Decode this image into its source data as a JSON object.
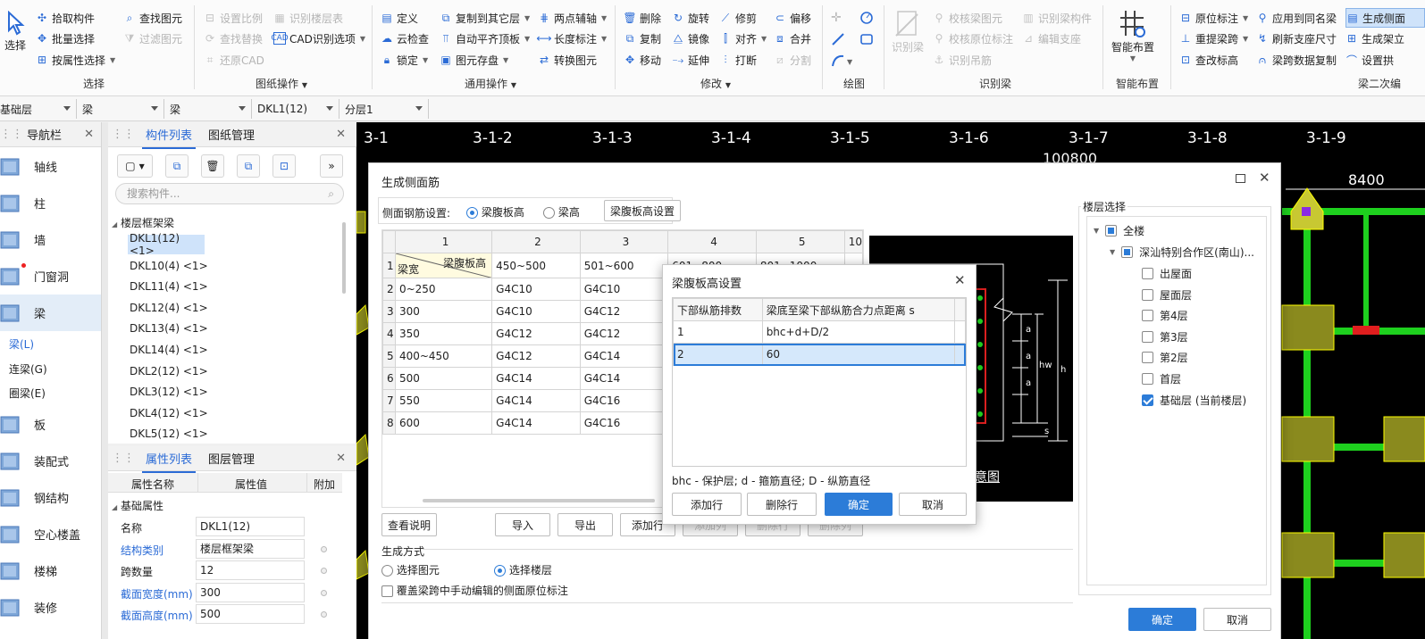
{
  "ribbon": {
    "select": {
      "label": "选择",
      "pick": "拾取构件",
      "batch": "批量选择",
      "by_attr": "按属性选择",
      "find": "查找图元",
      "filter": "过滤图元"
    },
    "drawing_ops": {
      "label": "图纸操作",
      "set_scale": "设置比例",
      "find_replace": "查找替换",
      "restore_cad": "还原CAD",
      "identify_floor": "识别楼层表",
      "cad_options": "CAD识别选项"
    },
    "general_ops": {
      "label": "通用操作",
      "define": "定义",
      "cloud_check": "云检查",
      "lock": "锁定",
      "copy_floor": "复制到其它层",
      "auto_flat": "自动平齐顶板",
      "elem_storage": "图元存盘",
      "two_point_axis": "两点辅轴",
      "length_mark": "长度标注",
      "convert_elem": "转换图元"
    },
    "modify": {
      "label": "修改",
      "delete": "删除",
      "copy": "复制",
      "move": "移动",
      "rotate": "旋转",
      "mirror": "镜像",
      "extend": "延伸",
      "trim": "修剪",
      "align": "对齐",
      "break": "打断",
      "offset": "偏移",
      "merge": "合并",
      "split": "分割"
    },
    "draw": {
      "label": "绘图"
    },
    "identify_beam": {
      "label": "识别梁",
      "identify": "识别梁",
      "check_beam": "校核梁图元",
      "check_orig": "校核原位标注",
      "hanger": "识别吊筋",
      "identify_comp": "识别梁构件",
      "edit_support": "编辑支座"
    },
    "smart_layout": {
      "label": "智能布置",
      "btn": "智能布置"
    },
    "beam_secondary": {
      "label": "梁二次编",
      "orig_mark": "原位标注",
      "re_span": "重提梁跨",
      "check_elev": "查改标高",
      "apply_same": "应用到同名梁",
      "refresh_support": "刷新支座尺寸",
      "span_copy": "梁跨数据复制",
      "gen_side": "生成侧面",
      "gen_hang": "生成架立",
      "set_arch": "设置拱"
    }
  },
  "selbar": {
    "floor": "基础层",
    "type1": "梁",
    "type2": "梁",
    "comp": "DKL1(12)",
    "layer": "分层1"
  },
  "nav": {
    "title": "导航栏",
    "items": [
      "轴线",
      "柱",
      "墙",
      "门窗洞",
      "梁",
      "板",
      "装配式",
      "钢结构",
      "空心楼盖",
      "楼梯",
      "装修"
    ],
    "beam_subs": [
      "梁(L)",
      "连梁(G)",
      "圈梁(E)"
    ]
  },
  "comp_panel": {
    "tab_list": "构件列表",
    "tab_drawing": "图纸管理",
    "search_placeholder": "搜索构件...",
    "group": "楼层框架梁",
    "items": [
      "DKL1(12) <1>",
      "DKL10(4) <1>",
      "DKL11(4) <1>",
      "DKL12(4) <1>",
      "DKL13(4) <1>",
      "DKL14(4) <1>",
      "DKL2(12) <1>",
      "DKL3(12) <1>",
      "DKL4(12) <1>",
      "DKL5(12) <1>"
    ]
  },
  "props": {
    "tab_props": "属性列表",
    "tab_layers": "图层管理",
    "col_name": "属性名称",
    "col_value": "属性值",
    "col_extra": "附加",
    "group": "基础属性",
    "rows": [
      {
        "name": "名称",
        "value": "DKL1(12)"
      },
      {
        "name": "结构类别",
        "value": "楼层框架梁"
      },
      {
        "name": "跨数量",
        "value": "12"
      },
      {
        "name": "截面宽度(mm)",
        "value": "300"
      },
      {
        "name": "截面高度(mm)",
        "value": "500"
      }
    ]
  },
  "cad": {
    "axes": [
      "3-1",
      "3-1-2",
      "3-1-3",
      "3-1-4",
      "3-1-5",
      "3-1-6",
      "3-1-7",
      "3-1-8",
      "3-1-9"
    ],
    "dim_total": "100800",
    "dim_right": "8400"
  },
  "main_dialog": {
    "title": "生成侧面筋",
    "setting_label": "侧面钢筋设置:",
    "opt_web": "梁腹板高",
    "opt_height": "梁高",
    "btn_web_setting": "梁腹板高设置",
    "col_nums": [
      "1",
      "2",
      "3",
      "4",
      "5",
      "10"
    ],
    "header_top": "梁腹板高",
    "header_bottom": "梁宽",
    "head_ranges": [
      "450~500",
      "501~600",
      "601~800",
      "801~1000"
    ],
    "rows": [
      {
        "n": "2",
        "w": "0~250",
        "c2": "G4C10",
        "c3": "G4C10"
      },
      {
        "n": "3",
        "w": "300",
        "c2": "G4C10",
        "c3": "G4C12"
      },
      {
        "n": "4",
        "w": "350",
        "c2": "G4C12",
        "c3": "G4C12"
      },
      {
        "n": "5",
        "w": "400~450",
        "c2": "G4C12",
        "c3": "G4C14"
      },
      {
        "n": "6",
        "w": "500",
        "c2": "G4C14",
        "c3": "G4C14"
      },
      {
        "n": "7",
        "w": "550",
        "c2": "G4C14",
        "c3": "G4C16"
      },
      {
        "n": "8",
        "w": "600",
        "c2": "G4C14",
        "c3": "G4C16"
      }
    ],
    "btn_view": "查看说明",
    "btn_import": "导入",
    "btn_export": "导出",
    "btn_add_row": "添加行",
    "btn_add_col": "添加列",
    "btn_del_row": "删除行",
    "btn_del_col": "删除列",
    "gen_label": "生成方式",
    "opt_elem": "选择图元",
    "opt_floor": "选择楼层",
    "overwrite": "覆盖梁跨中手动编辑的侧面原位标注",
    "diagram_caption": "意图",
    "floor_title": "楼层选择",
    "floors": {
      "all": "全楼",
      "zone": "深汕特别合作区(南山)...",
      "list": [
        "出屋面",
        "屋面层",
        "第4层",
        "第3层",
        "第2层",
        "首层",
        "基础层 (当前楼层)"
      ]
    },
    "btn_ok": "确定",
    "btn_cancel": "取消"
  },
  "sub_dialog": {
    "title": "梁腹板高设置",
    "col1": "下部纵筋排数",
    "col2": "梁底至梁下部纵筋合力点距离 s",
    "rows": [
      {
        "n": "1",
        "v": "bhc+d+D/2"
      },
      {
        "n": "2",
        "v": "60"
      }
    ],
    "note": "bhc - 保护层; d - 箍筋直径; D - 纵筋直径",
    "btn_add": "添加行",
    "btn_del": "删除行",
    "btn_ok": "确定",
    "btn_cancel": "取消"
  },
  "diagram_labels": {
    "a": "a",
    "hw": "hw",
    "h": "h",
    "s": "s"
  }
}
